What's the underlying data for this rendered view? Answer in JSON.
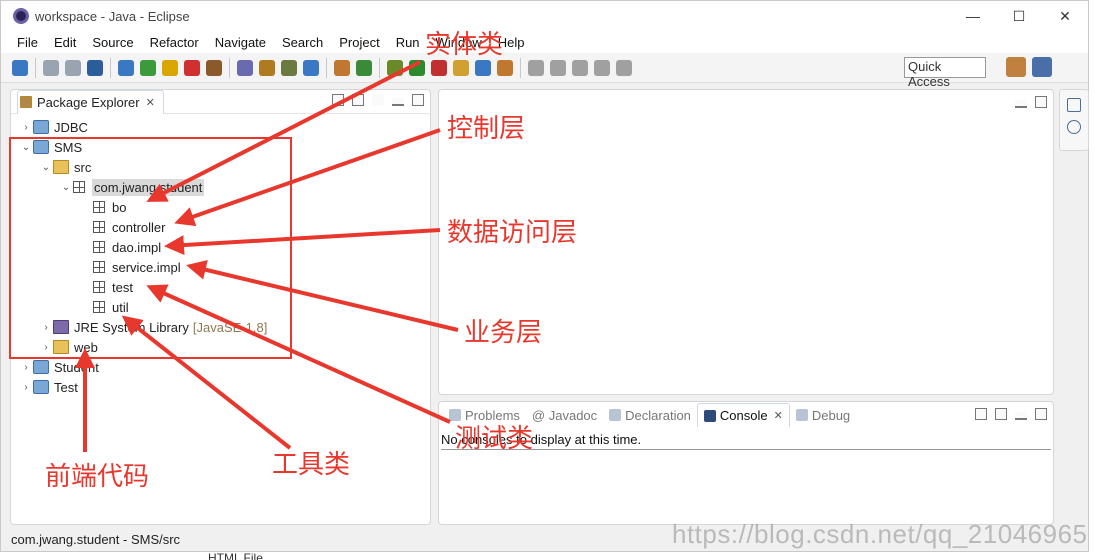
{
  "window": {
    "title": "workspace - Java - Eclipse",
    "controls": [
      "—",
      "☐",
      "✕"
    ]
  },
  "menu": [
    "File",
    "Edit",
    "Source",
    "Refactor",
    "Navigate",
    "Search",
    "Project",
    "Run",
    "Window",
    "Help"
  ],
  "toolbar": {
    "quick_access": "Quick Access",
    "icon_colors": [
      "#3a78c4",
      "#9aa4b0",
      "#9aa4b0",
      "#2d5c9a",
      "#3a78c4",
      "#3b9b3b",
      "#d9a500",
      "#d03030",
      "#8a5a2a",
      "#6a6ab0",
      "#b07a20",
      "#6a7a40",
      "#3a78c4",
      "#c07830",
      "#3a8a3a",
      "#6a8a2a",
      "#2c8a2c",
      "#c03030",
      "#d0a030",
      "#3a78c4",
      "#c07830",
      "#a0a0a0",
      "#a0a0a0",
      "#a0a0a0",
      "#a0a0a0",
      "#a0a0a0"
    ],
    "perspective_colors": [
      "#c08040",
      "#4a6ea8"
    ]
  },
  "package_explorer": {
    "title": "Package Explorer",
    "close_glyph": "✕",
    "tree": [
      {
        "label": "JDBC",
        "indent": 0,
        "chevron": "›",
        "icon": "project"
      },
      {
        "label": "SMS",
        "indent": 0,
        "chevron": "⌄",
        "icon": "project"
      },
      {
        "label": "src",
        "indent": 1,
        "chevron": "⌄",
        "icon": "folder"
      },
      {
        "label": "com.jwang.student",
        "indent": 2,
        "chevron": "⌄",
        "icon": "package",
        "selected": true
      },
      {
        "label": "bo",
        "indent": 3,
        "chevron": "",
        "icon": "package"
      },
      {
        "label": "controller",
        "indent": 3,
        "chevron": "",
        "icon": "package"
      },
      {
        "label": "dao.impl",
        "indent": 3,
        "chevron": "",
        "icon": "package"
      },
      {
        "label": "service.impl",
        "indent": 3,
        "chevron": "",
        "icon": "package"
      },
      {
        "label": "test",
        "indent": 3,
        "chevron": "",
        "icon": "package"
      },
      {
        "label": "util",
        "indent": 3,
        "chevron": "",
        "icon": "package"
      },
      {
        "label": "JRE System Library",
        "suffix": "[JavaSE-1.8]",
        "indent": 1,
        "chevron": "›",
        "icon": "library"
      },
      {
        "label": "web",
        "indent": 1,
        "chevron": "›",
        "icon": "folder"
      },
      {
        "label": "Student",
        "indent": 0,
        "chevron": "›",
        "icon": "project"
      },
      {
        "label": "Test",
        "indent": 0,
        "chevron": "›",
        "icon": "project"
      }
    ]
  },
  "console": {
    "tabs": [
      {
        "label": "Problems",
        "active": false
      },
      {
        "label": "@ Javadoc",
        "active": false
      },
      {
        "label": "Declaration",
        "active": false
      },
      {
        "label": "Console",
        "active": true,
        "close": "✕"
      },
      {
        "label": "Debug",
        "active": false
      }
    ],
    "message": "No consoles to display at this time."
  },
  "status_bar": "com.jwang.student - SMS/src",
  "behind_text": "HTML File",
  "watermark": "https://blog.csdn.net/qq_21046965",
  "annotations": {
    "color": "#e8382e",
    "labels": [
      "实体类",
      "控制层",
      "数据访问层",
      "业务层",
      "测试类",
      "工具类",
      "前端代码"
    ]
  }
}
